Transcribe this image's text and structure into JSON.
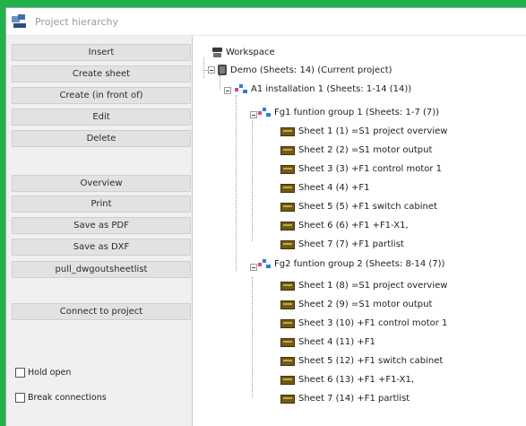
{
  "window": {
    "title": "Project hierarchy"
  },
  "buttons": {
    "insert": "Insert",
    "create_sheet": "Create sheet",
    "create_in_front": "Create (in front of)",
    "edit": "Edit",
    "delete": "Delete",
    "overview": "Overview",
    "print": "Print",
    "save_pdf": "Save as PDF",
    "save_dxf": "Save as DXF",
    "pull": "pull_dwgoutsheetlist",
    "connect": "Connect to project"
  },
  "checkboxes": {
    "hold_open": {
      "label": "Hold open",
      "checked": false
    },
    "break_connections": {
      "label": "Break connections",
      "checked": false
    }
  },
  "tree": {
    "workspace": "Workspace",
    "project": "Demo  (Sheets: 14)  (Current project)",
    "installation": "A1  installation 1  (Sheets: 1-14 (14))",
    "groups": [
      {
        "label": "Fg1  funtion group 1  (Sheets: 1-7 (7))",
        "sheets": [
          "Sheet 1 (1)  =S1  project overview",
          "Sheet 2 (2)  =S1  motor output",
          "Sheet 3 (3)  +F1  control motor 1",
          "Sheet 4 (4)  +F1",
          "Sheet 5 (5)  +F1  switch cabinet",
          "Sheet 6 (6)  +F1  +F1-X1,",
          "Sheet 7 (7)  +F1  partlist"
        ]
      },
      {
        "label": "Fg2  funtion group 2  (Sheets: 8-14 (7))",
        "sheets": [
          "Sheet 1 (8)  =S1  project overview",
          "Sheet 2 (9)  =S1  motor output",
          "Sheet 3 (10)  +F1  control motor 1",
          "Sheet 4 (11)  +F1",
          "Sheet 5 (12)  +F1  switch cabinet",
          "Sheet 6 (13)  +F1  +F1-X1,",
          "Sheet 7 (14)  +F1  partlist"
        ]
      }
    ]
  },
  "colors": {
    "frame": "#22b24c",
    "panel": "#f0f0f0",
    "button": "#e2e2e2",
    "tree_bg": "#ffffff"
  }
}
